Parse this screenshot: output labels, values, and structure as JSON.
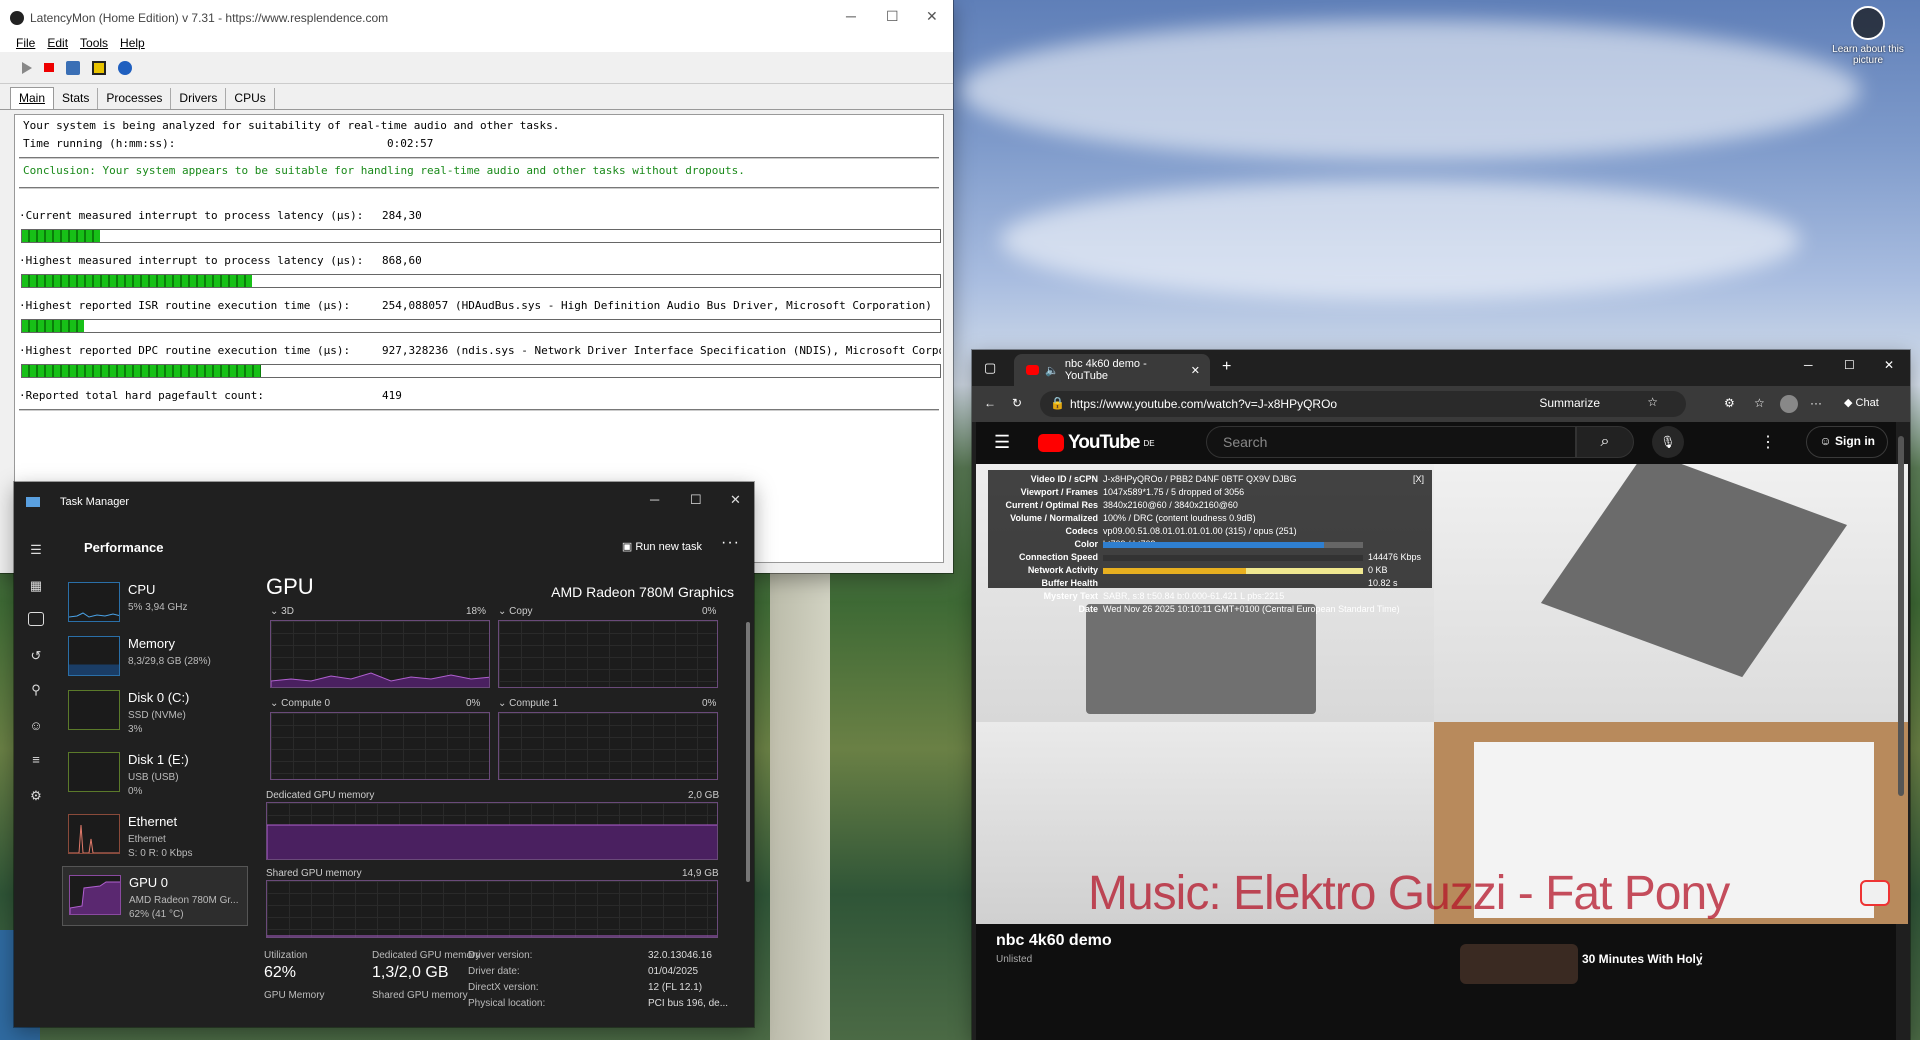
{
  "desktop": {
    "learn_label": "Learn about this picture"
  },
  "latencymon": {
    "title": "LatencyMon  (Home Edition)  v 7.31 - https://www.resplendence.com",
    "menu": [
      "File",
      "Edit",
      "Tools",
      "Help"
    ],
    "tabs": [
      "Main",
      "Stats",
      "Processes",
      "Drivers",
      "CPUs"
    ],
    "line1": "Your system is being analyzed for suitability of real-time audio and other tasks.",
    "line2_label": "Time running (h:mm:ss):",
    "time_running": "0:02:57",
    "conclusion": "Conclusion: Your system appears to be suitable for handling real-time audio and other tasks without dropouts.",
    "metrics": [
      {
        "label": "·Current measured interrupt to process latency (µs):",
        "value": "284,30",
        "extra": "",
        "fill": 0.085
      },
      {
        "label": "·Highest measured interrupt to process latency (µs):",
        "value": "868,60",
        "extra": "",
        "fill": 0.25
      },
      {
        "label": "·Highest reported ISR routine execution time (µs):",
        "value": "254,088057",
        "extra": "(HDAudBus.sys - High Definition Audio Bus Driver, Microsoft Corporation)",
        "fill": 0.067
      },
      {
        "label": "·Highest reported DPC routine execution time (µs):",
        "value": "927,328236",
        "extra": "(ndis.sys - Network Driver Interface Specification (NDIS), Microsoft Corporatio",
        "fill": 0.26
      }
    ],
    "pagefault_label": "·Reported total hard pagefault count:",
    "pagefault_value": "419"
  },
  "taskmanager": {
    "title": "Task Manager",
    "header": "Performance",
    "run_new_task": "Run new task",
    "sidebar": [
      {
        "name": "CPU",
        "s1": "5% 3,94 GHz",
        "s2": ""
      },
      {
        "name": "Memory",
        "s1": "8,3/29,8 GB (28%)",
        "s2": ""
      },
      {
        "name": "Disk 0 (C:)",
        "s1": "SSD (NVMe)",
        "s2": "3%"
      },
      {
        "name": "Disk 1 (E:)",
        "s1": "USB (USB)",
        "s2": "0%"
      },
      {
        "name": "Ethernet",
        "s1": "Ethernet",
        "s2": "S: 0 R: 0 Kbps"
      },
      {
        "name": "GPU 0",
        "s1": "AMD Radeon 780M Gr...",
        "s2": "62% (41 °C)"
      }
    ],
    "gpu_title": "GPU",
    "gpu_model": "AMD Radeon 780M Graphics",
    "engines": [
      {
        "name": "3D",
        "pct": "18%"
      },
      {
        "name": "Copy",
        "pct": "0%"
      },
      {
        "name": "Compute 0",
        "pct": "0%"
      },
      {
        "name": "Compute 1",
        "pct": "0%"
      }
    ],
    "dedicated_label": "Dedicated GPU memory",
    "dedicated_max": "2,0 GB",
    "shared_label": "Shared GPU memory",
    "shared_max": "14,9 GB",
    "stats": {
      "utilization_label": "Utilization",
      "utilization": "62%",
      "dedicated_label": "Dedicated GPU memory",
      "dedicated": "1,3/2,0 GB",
      "gpu_memory_label": "GPU Memory",
      "shared_label": "Shared GPU memory"
    },
    "details": [
      {
        "k": "Driver version:",
        "v": "32.0.13046.16"
      },
      {
        "k": "Driver date:",
        "v": "01/04/2025"
      },
      {
        "k": "DirectX version:",
        "v": "12 (FL 12.1)"
      },
      {
        "k": "Physical location:",
        "v": "PCI bus 196, de..."
      }
    ]
  },
  "browser": {
    "tab_title": "nbc 4k60 demo - YouTube",
    "url": "https://www.youtube.com/watch?v=J-x8HPyQROo",
    "summarize": "Summarize",
    "chat": "Chat",
    "brand": "YouTube",
    "brand_region": "DE",
    "search_placeholder": "Search",
    "sign_in": "Sign in",
    "video_title": "nbc 4k60 demo",
    "unlisted": "Unlisted",
    "related_title": "30 Minutes With Holy",
    "lyric_overlay": "Music: Elektro Guzzi - Fat Pony",
    "stats_close": "[X]",
    "stats": [
      {
        "k": "Video ID / sCPN",
        "v": "J-x8HPyQROo  /  PBB2 D4NF 0BTF QX9V DJBG"
      },
      {
        "k": "Viewport / Frames",
        "v": "1047x589*1.75 / 5 dropped of 3056"
      },
      {
        "k": "Current / Optimal Res",
        "v": "3840x2160@60 / 3840x2160@60"
      },
      {
        "k": "Volume / Normalized",
        "v": "100% / DRC (content loudness 0.9dB)"
      },
      {
        "k": "Codecs",
        "v": "vp09.00.51.08.01.01.01.01.00 (315) / opus (251)"
      },
      {
        "k": "Color",
        "v": "bt709 / bt709"
      },
      {
        "k": "Connection Speed",
        "v": "144476 Kbps"
      },
      {
        "k": "Network Activity",
        "v": "0 KB"
      },
      {
        "k": "Buffer Health",
        "v": "10.82 s"
      },
      {
        "k": "Mystery Text",
        "v": "SABR, s:8 t:50.84 b:0.000-61.421 L pbs:2215"
      },
      {
        "k": "Date",
        "v": "Wed Nov 26 2025 10:10:11 GMT+0100 (Central European Standard Time)"
      }
    ]
  }
}
